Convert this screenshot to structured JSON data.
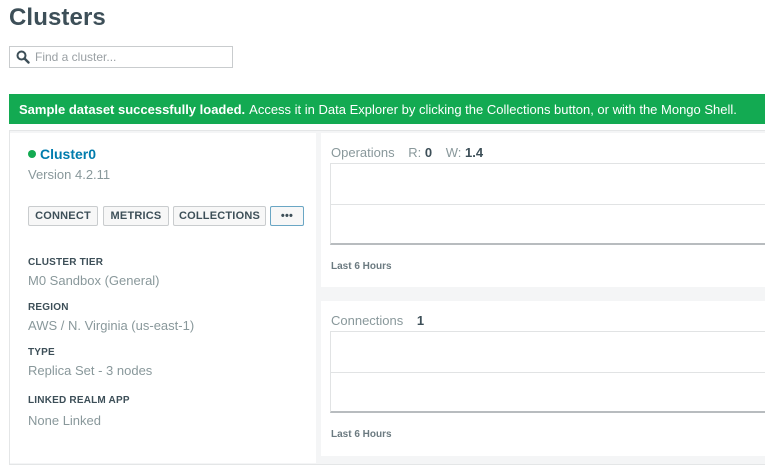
{
  "page": {
    "title": "Clusters"
  },
  "search": {
    "placeholder": "Find a cluster..."
  },
  "banner": {
    "bold": "Sample dataset successfully loaded.",
    "text": "Access it in Data Explorer by clicking the Collections button, or with the Mongo Shell."
  },
  "cluster": {
    "name": "Cluster0",
    "status_color": "#13aa52",
    "version": "Version 4.2.11",
    "buttons": {
      "connect": "CONNECT",
      "metrics": "METRICS",
      "collections": "COLLECTIONS",
      "more": "•••"
    },
    "details": [
      {
        "label": "CLUSTER TIER",
        "value": "M0 Sandbox (General)"
      },
      {
        "label": "REGION",
        "value": "AWS / N. Virginia (us-east-1)"
      },
      {
        "label": "TYPE",
        "value": "Replica Set - 3 nodes"
      },
      {
        "label": "LINKED REALM APP",
        "value": "None Linked"
      }
    ]
  },
  "operations_chart": {
    "title": "Operations",
    "r_label": "R:",
    "r_value": "0",
    "w_label": "W:",
    "w_value": "1.4",
    "footer": "Last 6 Hours"
  },
  "connections_chart": {
    "title": "Connections",
    "value": "1",
    "footer": "Last 6 Hours"
  },
  "colors": {
    "accent": "#13aa52",
    "link": "#007cad"
  }
}
